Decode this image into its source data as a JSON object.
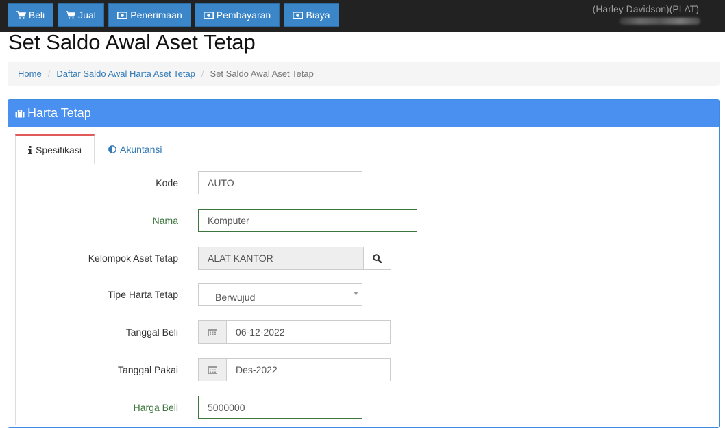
{
  "nav": {
    "buttons": [
      {
        "label": "Beli",
        "icon": "cart-icon"
      },
      {
        "label": "Jual",
        "icon": "cart-icon"
      },
      {
        "label": "Penerimaan",
        "icon": "money-icon"
      },
      {
        "label": "Pembayaran",
        "icon": "money-icon"
      },
      {
        "label": "Biaya",
        "icon": "money-icon"
      }
    ],
    "user": "(Harley Davidson)(PLAT)"
  },
  "page": {
    "title": "Set Saldo Awal Aset Tetap"
  },
  "breadcrumb": {
    "home": "Home",
    "list": "Daftar Saldo Awal Harta Aset Tetap",
    "current": "Set Saldo Awal Aset Tetap"
  },
  "panel": {
    "title": "Harta Tetap",
    "icon": "briefcase-icon"
  },
  "tabs": {
    "spesifikasi": "Spesifikasi",
    "akuntansi": "Akuntansi"
  },
  "form": {
    "kode": {
      "label": "Kode",
      "value": "AUTO"
    },
    "nama": {
      "label": "Nama",
      "value": "Komputer"
    },
    "kelompok": {
      "label": "Kelompok Aset Tetap",
      "value": "ALAT KANTOR"
    },
    "tipe": {
      "label": "Tipe Harta Tetap",
      "value": "Berwujud"
    },
    "tanggal_beli": {
      "label": "Tanggal Beli",
      "value": "06-12-2022"
    },
    "tanggal_pakai": {
      "label": "Tanggal Pakai",
      "value": "Des-2022"
    },
    "harga_beli": {
      "label": "Harga Beli",
      "value": "5000000"
    }
  },
  "colors": {
    "nav_bg": "#222222",
    "button_blue": "#3b86c8",
    "panel_blue": "#4a90f0",
    "active_tab_accent": "#e05a5a",
    "success_green": "#3c763d"
  }
}
